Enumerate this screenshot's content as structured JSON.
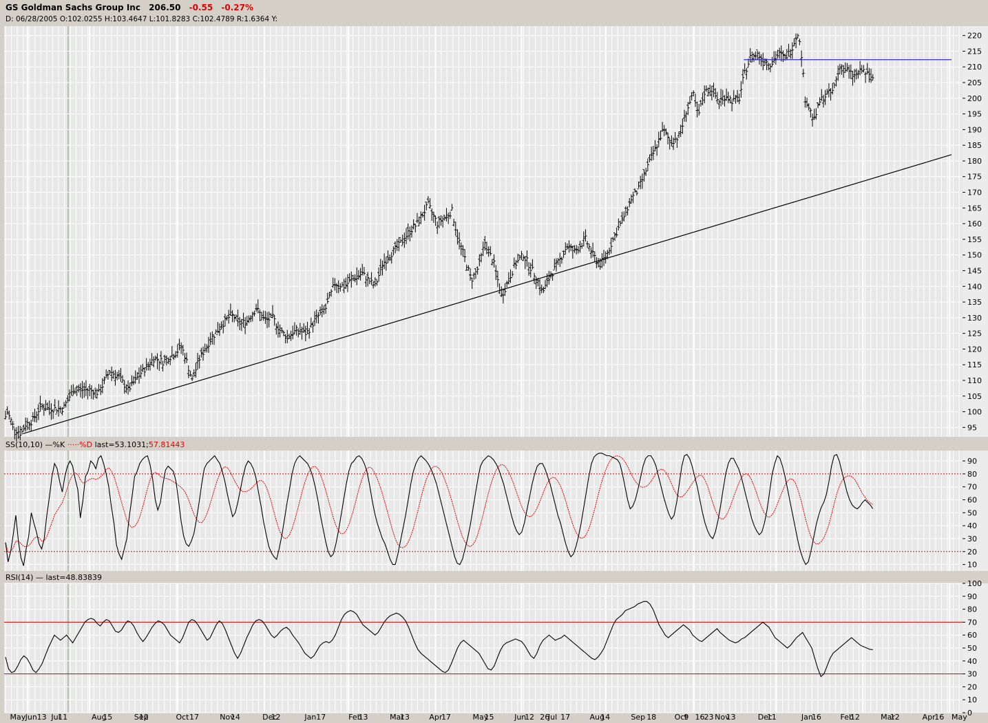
{
  "header": {
    "name": "GS Goldman Sachs Group Inc",
    "price": "206.50",
    "change": "-0.55",
    "change_pct": "-0.27%",
    "ohlc_line": "D: 06/28/2005 O:102.0255 H:103.4647 L:101.8283 C:102.4789 R:1.6364 Y:"
  },
  "colors": {
    "background": "#d4d0c8",
    "panel": "#e8e8e8",
    "grid": "#ffffff",
    "price": "#000000",
    "negative": "#e00000",
    "resistance": "#3030c0",
    "stoch_d": "#e00000",
    "level_line": "#c00000"
  },
  "chart_data": [
    {
      "type": "ohlc",
      "panel": "price",
      "y_ticks": [
        95,
        100,
        105,
        110,
        115,
        120,
        125,
        130,
        135,
        140,
        145,
        150,
        155,
        160,
        165,
        170,
        175,
        180,
        185,
        190,
        195,
        200,
        205,
        210,
        215,
        220
      ],
      "ylim": [
        92,
        223
      ],
      "x_start": "May 2005",
      "x_end": "May 2007",
      "close_path": [
        {
          "t": 0,
          "v": 101
        },
        {
          "t": 0.05,
          "v": 96
        },
        {
          "t": 0.1,
          "v": 100
        },
        {
          "t": 0.17,
          "v": 95
        },
        {
          "t": 0.25,
          "v": 93
        },
        {
          "t": 0.3,
          "v": 96
        },
        {
          "t": 0.37,
          "v": 97
        },
        {
          "t": 0.47,
          "v": 102
        },
        {
          "t": 0.55,
          "v": 101
        },
        {
          "t": 0.63,
          "v": 101
        },
        {
          "t": 0.71,
          "v": 101
        },
        {
          "t": 0.82,
          "v": 107
        },
        {
          "t": 0.92,
          "v": 107
        },
        {
          "t": 1.0,
          "v": 107
        },
        {
          "t": 1.1,
          "v": 106
        },
        {
          "t": 1.22,
          "v": 113
        },
        {
          "t": 1.32,
          "v": 111
        },
        {
          "t": 1.42,
          "v": 107
        },
        {
          "t": 1.55,
          "v": 112
        },
        {
          "t": 1.7,
          "v": 117
        },
        {
          "t": 1.8,
          "v": 116
        },
        {
          "t": 1.95,
          "v": 119
        },
        {
          "t": 2.0,
          "v": 121
        },
        {
          "t": 2.05,
          "v": 117
        },
        {
          "t": 2.12,
          "v": 110
        },
        {
          "t": 2.2,
          "v": 117
        },
        {
          "t": 2.32,
          "v": 123
        },
        {
          "t": 2.45,
          "v": 128
        },
        {
          "t": 2.55,
          "v": 131
        },
        {
          "t": 2.65,
          "v": 128
        },
        {
          "t": 2.72,
          "v": 129
        },
        {
          "t": 2.82,
          "v": 133
        },
        {
          "t": 2.92,
          "v": 129
        },
        {
          "t": 3.0,
          "v": 130
        },
        {
          "t": 3.08,
          "v": 126
        },
        {
          "t": 3.15,
          "v": 124
        },
        {
          "t": 3.27,
          "v": 126
        },
        {
          "t": 3.37,
          "v": 125
        },
        {
          "t": 3.48,
          "v": 130
        },
        {
          "t": 3.58,
          "v": 133
        },
        {
          "t": 3.68,
          "v": 141
        },
        {
          "t": 3.78,
          "v": 140
        },
        {
          "t": 3.9,
          "v": 143
        },
        {
          "t": 3.98,
          "v": 144
        },
        {
          "t": 4.05,
          "v": 142
        },
        {
          "t": 4.12,
          "v": 140
        },
        {
          "t": 4.2,
          "v": 147
        },
        {
          "t": 4.28,
          "v": 150
        },
        {
          "t": 4.38,
          "v": 153
        },
        {
          "t": 4.48,
          "v": 157
        },
        {
          "t": 4.58,
          "v": 160
        },
        {
          "t": 4.7,
          "v": 166
        },
        {
          "t": 4.8,
          "v": 160
        },
        {
          "t": 4.88,
          "v": 162
        },
        {
          "t": 4.96,
          "v": 164
        },
        {
          "t": 5.02,
          "v": 156
        },
        {
          "t": 5.1,
          "v": 149
        },
        {
          "t": 5.17,
          "v": 142
        },
        {
          "t": 5.25,
          "v": 146
        },
        {
          "t": 5.32,
          "v": 154
        },
        {
          "t": 5.42,
          "v": 147
        },
        {
          "t": 5.5,
          "v": 137
        },
        {
          "t": 5.55,
          "v": 140
        },
        {
          "t": 5.65,
          "v": 147
        },
        {
          "t": 5.74,
          "v": 150
        },
        {
          "t": 5.8,
          "v": 147
        },
        {
          "t": 5.88,
          "v": 143
        },
        {
          "t": 5.95,
          "v": 138
        },
        {
          "t": 6.03,
          "v": 143
        },
        {
          "t": 6.13,
          "v": 148
        },
        {
          "t": 6.22,
          "v": 153
        },
        {
          "t": 6.3,
          "v": 151
        },
        {
          "t": 6.42,
          "v": 155
        },
        {
          "t": 6.5,
          "v": 150
        },
        {
          "t": 6.58,
          "v": 147
        },
        {
          "t": 6.65,
          "v": 150
        },
        {
          "t": 6.72,
          "v": 155
        },
        {
          "t": 6.82,
          "v": 161
        },
        {
          "t": 6.92,
          "v": 168
        },
        {
          "t": 7.0,
          "v": 171
        },
        {
          "t": 7.08,
          "v": 177
        },
        {
          "t": 7.17,
          "v": 183
        },
        {
          "t": 7.27,
          "v": 190
        },
        {
          "t": 7.35,
          "v": 186
        },
        {
          "t": 7.45,
          "v": 188
        },
        {
          "t": 7.52,
          "v": 196
        },
        {
          "t": 7.6,
          "v": 201
        },
        {
          "t": 7.65,
          "v": 194
        },
        {
          "t": 7.72,
          "v": 202
        },
        {
          "t": 7.8,
          "v": 203
        },
        {
          "t": 7.87,
          "v": 199
        },
        {
          "t": 7.95,
          "v": 201
        },
        {
          "t": 8.03,
          "v": 199
        },
        {
          "t": 8.1,
          "v": 200
        },
        {
          "t": 8.15,
          "v": 207
        },
        {
          "t": 8.22,
          "v": 213
        },
        {
          "t": 8.3,
          "v": 214
        },
        {
          "t": 8.38,
          "v": 212
        },
        {
          "t": 8.45,
          "v": 211
        },
        {
          "t": 8.53,
          "v": 214
        },
        {
          "t": 8.6,
          "v": 213
        },
        {
          "t": 8.66,
          "v": 215
        },
        {
          "t": 8.74,
          "v": 221
        },
        {
          "t": 8.78,
          "v": 214
        },
        {
          "t": 8.82,
          "v": 200
        },
        {
          "t": 8.92,
          "v": 193
        },
        {
          "t": 8.98,
          "v": 199
        },
        {
          "t": 9.05,
          "v": 201
        },
        {
          "t": 9.12,
          "v": 202
        },
        {
          "t": 9.2,
          "v": 210
        },
        {
          "t": 9.27,
          "v": 209
        },
        {
          "t": 9.35,
          "v": 207
        },
        {
          "t": 9.45,
          "v": 209
        },
        {
          "t": 9.52,
          "v": 207
        },
        {
          "t": 9.56,
          "v": 206.5
        }
      ],
      "trendline": [
        {
          "t": 0.27,
          "v": 93
        },
        {
          "t": 10.42,
          "v": 182
        }
      ],
      "resistance": {
        "t1": 8.15,
        "t2": 10.42,
        "v": 212.3
      }
    },
    {
      "type": "line",
      "panel": "stochastic",
      "label": "SS(10,10)",
      "series": [
        {
          "name": "%K",
          "color": "#000000",
          "dash": false
        },
        {
          "name": "%D",
          "color": "#e00000",
          "dash": true
        }
      ],
      "last_k": "53.1031",
      "last_d": "57.81443",
      "y_ticks": [
        10,
        20,
        30,
        40,
        50,
        60,
        70,
        80,
        90
      ],
      "ylim": [
        5,
        98
      ],
      "levels": [
        20,
        80
      ],
      "k_values": [
        27,
        12,
        20,
        33,
        48,
        28,
        15,
        9,
        22,
        32,
        50,
        42,
        35,
        26,
        22,
        30,
        48,
        62,
        78,
        88,
        84,
        74,
        66,
        78,
        86,
        90,
        86,
        76,
        68,
        46,
        60,
        78,
        82,
        90,
        88,
        84,
        92,
        94,
        88,
        80,
        70,
        55,
        42,
        25,
        18,
        14,
        22,
        30,
        48,
        62,
        78,
        82,
        88,
        91,
        93,
        94,
        87,
        76,
        60,
        52,
        58,
        72,
        83,
        86,
        84,
        82,
        75,
        60,
        44,
        32,
        26,
        24,
        28,
        34,
        45,
        58,
        72,
        84,
        88,
        90,
        92,
        94,
        91,
        88,
        82,
        74,
        64,
        55,
        47,
        50,
        58,
        68,
        78,
        86,
        90,
        88,
        84,
        77,
        66,
        55,
        43,
        33,
        24,
        19,
        16,
        14,
        22,
        32,
        44,
        57,
        68,
        80,
        88,
        92,
        94,
        92,
        90,
        88,
        84,
        78,
        70,
        60,
        48,
        38,
        28,
        20,
        16,
        18,
        26,
        36,
        48,
        60,
        72,
        82,
        88,
        90,
        93,
        94,
        92,
        88,
        82,
        72,
        60,
        50,
        42,
        36,
        30,
        26,
        20,
        14,
        10,
        10,
        18,
        28,
        38,
        48,
        60,
        72,
        82,
        88,
        92,
        94,
        92,
        90,
        87,
        83,
        78,
        72,
        64,
        56,
        48,
        40,
        32,
        24,
        16,
        11,
        10,
        14,
        22,
        30,
        40,
        52,
        64,
        76,
        86,
        90,
        92,
        94,
        93,
        91,
        88,
        84,
        78,
        72,
        64,
        56,
        48,
        41,
        36,
        33,
        35,
        42,
        52,
        62,
        72,
        80,
        86,
        88,
        88,
        84,
        78,
        72,
        64,
        56,
        48,
        42,
        34,
        26,
        20,
        16,
        18,
        24,
        32,
        42,
        54,
        66,
        78,
        88,
        93,
        95,
        96,
        96,
        95,
        94,
        94,
        93,
        92,
        91,
        88,
        80,
        70,
        60,
        53,
        55,
        60,
        68,
        77,
        86,
        92,
        94,
        94,
        91,
        86,
        78,
        70,
        62,
        55,
        49,
        45,
        48,
        58,
        72,
        86,
        94,
        95,
        92,
        86,
        78,
        70,
        60,
        50,
        42,
        36,
        32,
        30,
        35,
        44,
        55,
        68,
        80,
        88,
        92,
        92,
        88,
        84,
        78,
        70,
        62,
        54,
        46,
        40,
        36,
        33,
        35,
        42,
        52,
        66,
        80,
        88,
        94,
        92,
        86,
        78,
        68,
        58,
        48,
        38,
        28,
        20,
        14,
        10,
        12,
        20,
        30,
        40,
        48,
        54,
        58,
        64,
        74,
        86,
        94,
        95,
        90,
        82,
        74,
        66,
        60,
        56,
        54,
        53,
        55,
        58,
        60,
        58,
        56,
        53.1
      ]
    },
    {
      "type": "line",
      "panel": "rsi",
      "label": "RSI(14)",
      "last": "48.83839",
      "y_ticks": [
        0,
        10,
        20,
        30,
        40,
        50,
        60,
        70,
        80,
        90,
        100
      ],
      "ylim": [
        0,
        100
      ],
      "levels": [
        30,
        70
      ],
      "values": [
        43,
        34,
        31,
        32,
        36,
        41,
        44,
        42,
        38,
        33,
        31,
        34,
        38,
        44,
        50,
        55,
        60,
        58,
        56,
        58,
        60,
        57,
        54,
        58,
        62,
        66,
        70,
        72,
        73,
        72,
        69,
        67,
        70,
        72,
        71,
        67,
        63,
        62,
        64,
        68,
        71,
        70,
        67,
        62,
        58,
        55,
        58,
        62,
        66,
        69,
        71,
        70,
        68,
        64,
        60,
        58,
        56,
        54,
        58,
        64,
        70,
        72,
        71,
        68,
        64,
        60,
        56,
        58,
        63,
        68,
        71,
        69,
        64,
        58,
        52,
        46,
        42,
        46,
        52,
        58,
        63,
        68,
        71,
        72,
        71,
        68,
        64,
        60,
        58,
        60,
        63,
        65,
        66,
        64,
        60,
        57,
        54,
        50,
        46,
        44,
        42,
        44,
        48,
        52,
        54,
        55,
        54,
        56,
        60,
        66,
        72,
        76,
        78,
        79,
        78,
        76,
        72,
        68,
        66,
        64,
        62,
        60,
        62,
        66,
        70,
        73,
        75,
        76,
        77,
        76,
        74,
        71,
        66,
        60,
        54,
        49,
        46,
        44,
        42,
        40,
        38,
        36,
        34,
        32,
        31,
        33,
        38,
        44,
        50,
        54,
        56,
        54,
        52,
        50,
        48,
        46,
        42,
        38,
        34,
        33,
        36,
        42,
        48,
        52,
        54,
        55,
        56,
        57,
        56,
        55,
        52,
        48,
        44,
        42,
        46,
        52,
        56,
        58,
        60,
        58,
        56,
        57,
        58,
        60,
        58,
        56,
        54,
        52,
        50,
        48,
        46,
        44,
        42,
        41,
        43,
        46,
        50,
        56,
        62,
        68,
        72,
        74,
        76,
        79,
        80,
        81,
        82,
        84,
        85,
        86,
        86,
        84,
        80,
        74,
        68,
        64,
        60,
        58,
        60,
        62,
        64,
        66,
        68,
        66,
        64,
        60,
        58,
        56,
        55,
        57,
        59,
        61,
        63,
        65,
        62,
        60,
        58,
        56,
        55,
        54,
        55,
        57,
        58,
        60,
        62,
        64,
        66,
        68,
        70,
        68,
        66,
        62,
        58,
        56,
        54,
        52,
        50,
        52,
        55,
        58,
        60,
        62,
        58,
        54,
        50,
        42,
        34,
        28,
        30,
        36,
        42,
        46,
        48,
        50,
        52,
        54,
        56,
        58,
        56,
        54,
        52,
        51,
        50,
        49,
        48.8
      ]
    }
  ],
  "x_axis": {
    "labels": [
      "May",
      "Jun",
      "13",
      "Jul",
      "11",
      "Aug",
      "15",
      "Sep",
      "12",
      "Oct",
      "17",
      "Nov",
      "14",
      "Dec",
      "12",
      "Jan",
      "17",
      "Feb",
      "13",
      "Mar",
      "13",
      "Apr",
      "17",
      "May",
      "15",
      "Jun",
      "12",
      "26",
      "Jul",
      "17",
      "Aug",
      "14",
      "Sep",
      "18",
      "Oct",
      "9",
      "16",
      "23",
      "Nov",
      "13",
      "Dec",
      "11",
      "Jan",
      "16",
      "Feb",
      "12",
      "Mar",
      "12",
      "Apr",
      "16",
      "May"
    ]
  }
}
